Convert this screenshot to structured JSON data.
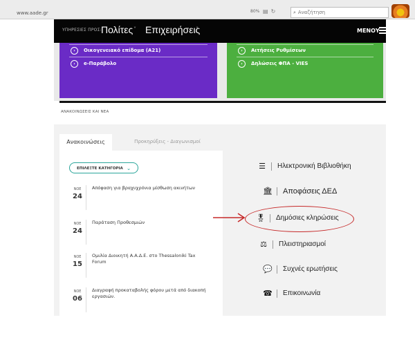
{
  "browser": {
    "url": "www.aade.gr",
    "zoom": "80%",
    "search_placeholder": "Αναζήτηση"
  },
  "header": {
    "services_label": "ΥΠΗΡΕΣΙΕΣ ΠΡΟΣ:",
    "nav": [
      {
        "label": "Πολίτες"
      },
      {
        "label": "Επιχειρήσεις"
      }
    ],
    "menu_label": "ΜΕΝΟΥ"
  },
  "tiles": {
    "purple": {
      "color": "#6a2bc6",
      "links": [
        {
          "label": "Οικογενειακό επίδομα (Α21)"
        },
        {
          "label": "e-Παράβολο"
        }
      ]
    },
    "green": {
      "color": "#4caf3f",
      "links": [
        {
          "label": "Αιτήσεις Ρυθμίσεων"
        },
        {
          "label": "Δηλώσεις ΦΠΑ - VIES"
        }
      ]
    }
  },
  "news": {
    "heading": "ΑΝΑΚΟΙΝΩΣΕΙΣ ΚΑΙ ΝΕΑ",
    "tabs": [
      {
        "label": "Ανακοινώσεις",
        "active": true
      },
      {
        "label": "Προκηρύξεις - Διαγωνισμοί",
        "active": false
      }
    ],
    "category_button": "ΕΠΙΛΕΞΤΕ ΚΑΤΗΓΟΡΙΑ",
    "items": [
      {
        "month": "ΝΟΕ",
        "day": "24",
        "title": "Απόφαση για βραχυχρόνια μίσθωση ακινήτων"
      },
      {
        "month": "ΝΟΕ",
        "day": "24",
        "title": "Παράταση Προθεσμιών"
      },
      {
        "month": "ΝΟΕ",
        "day": "15",
        "title": "Ομιλία Διοικητή Α.Α.Δ.Ε. στο Thessaloniki Tax Forum"
      },
      {
        "month": "ΝΟΕ",
        "day": "06",
        "title": "Διαγραφή προκαταβολής φόρου μετά από διακοπή εργασιών."
      }
    ]
  },
  "quick_links": [
    {
      "label": "Ηλεκτρονική Βιβλιοθήκη",
      "icon": "books-icon"
    },
    {
      "label": "Αποφάσεις ΔΕΔ",
      "icon": "bank-icon"
    },
    {
      "label": "Δημόσιες κληρώσεις",
      "icon": "award-icon",
      "highlighted": true
    },
    {
      "label": "Πλειστηριασμοί",
      "icon": "gavel-icon"
    },
    {
      "label": "Συχνές ερωτήσεις",
      "icon": "chat-icon"
    },
    {
      "label": "Επικοινωνία",
      "icon": "phone-icon"
    }
  ],
  "colors": {
    "accent_teal": "#2aa59a",
    "annotation_red": "#c62828"
  }
}
